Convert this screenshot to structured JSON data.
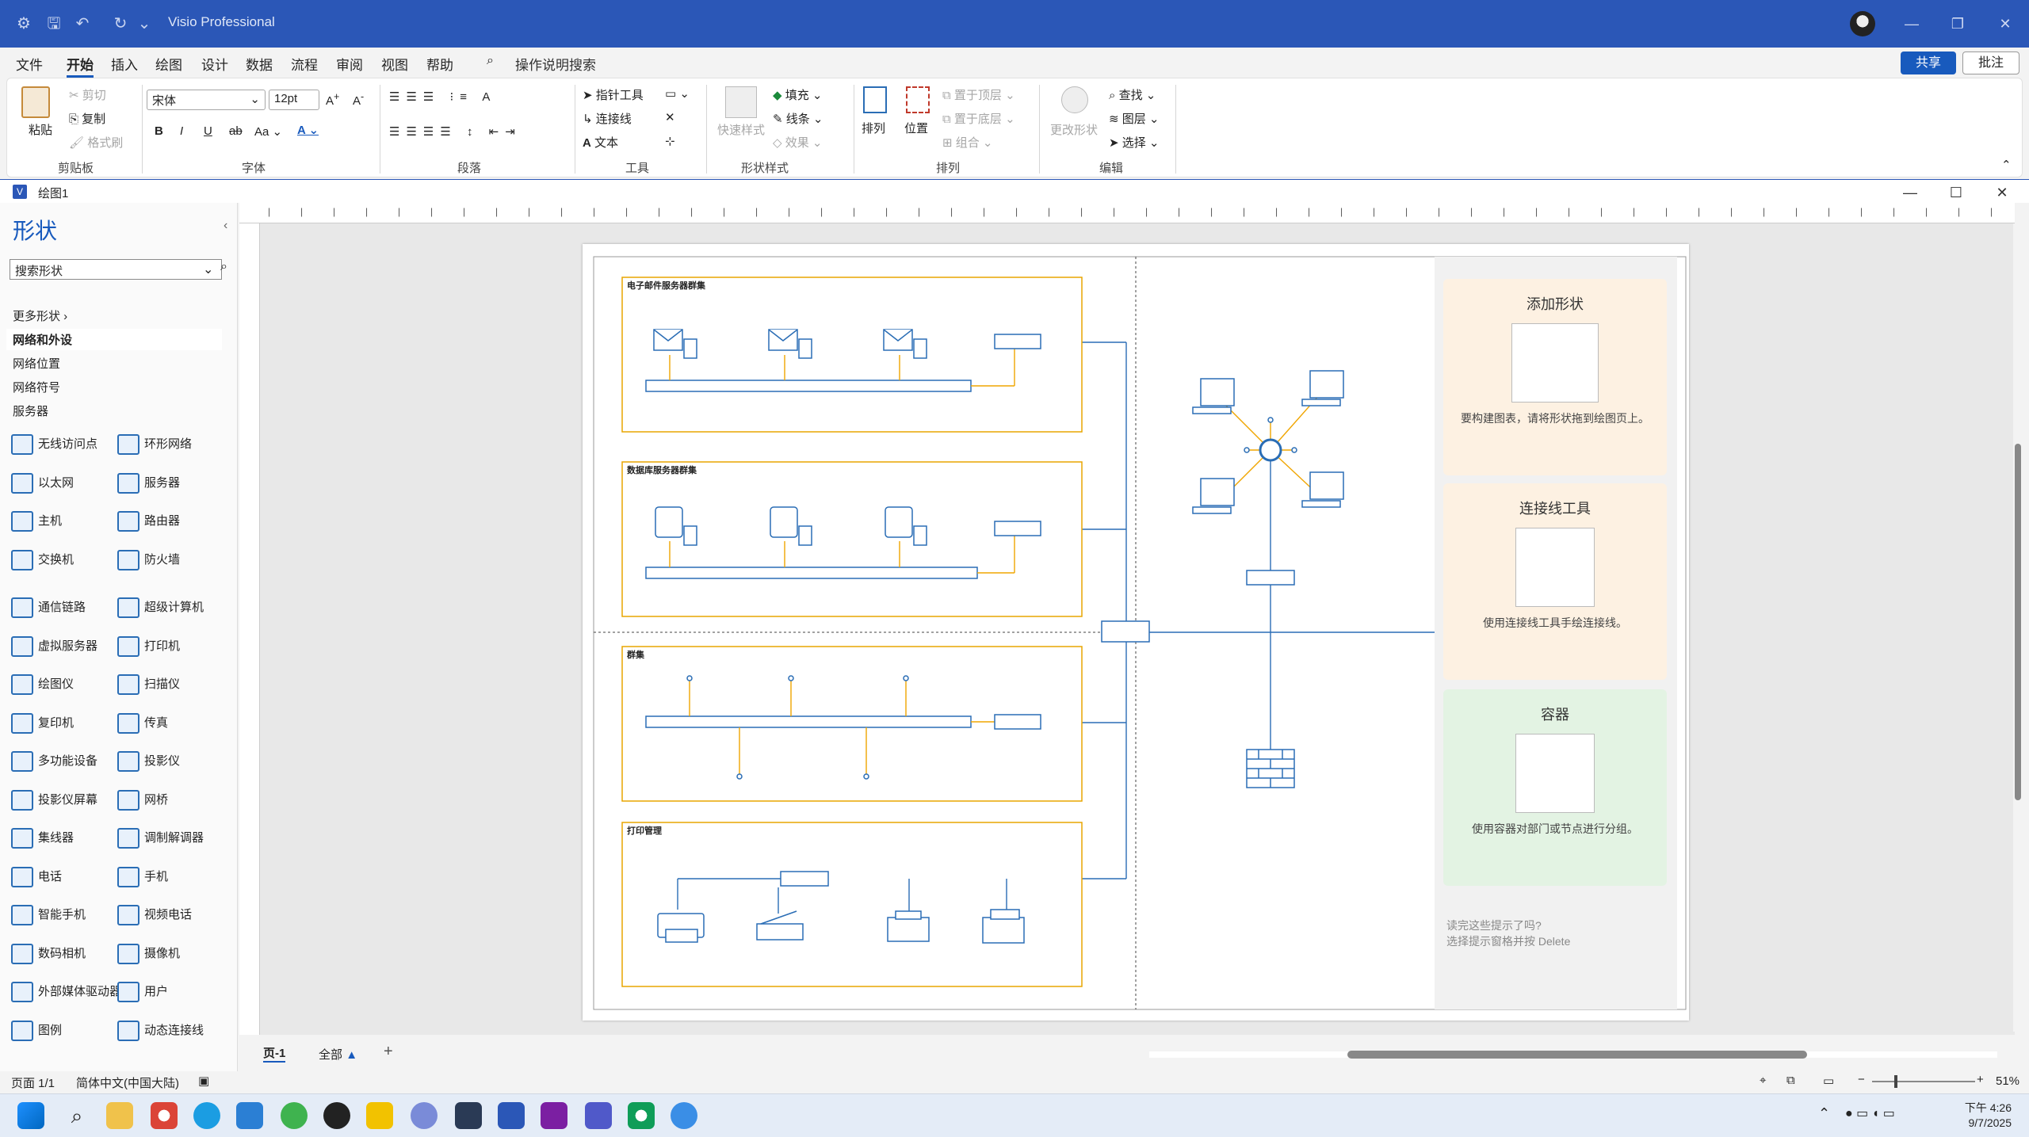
{
  "titlebar": {
    "app_title": "Visio Professional"
  },
  "menu": {
    "tabs": [
      "文件",
      "开始",
      "插入",
      "绘图",
      "设计",
      "数据",
      "流程",
      "审阅",
      "视图",
      "帮助"
    ],
    "active": "开始",
    "tell_me": "操作说明搜索",
    "share": "共享",
    "comment": "批注"
  },
  "ribbon": {
    "clipboard": {
      "paste": "粘贴",
      "cut": "剪切",
      "copy": "复制",
      "format_painter": "格式刷",
      "label": "剪贴板"
    },
    "font": {
      "family": "宋体",
      "size": "12pt",
      "label": "字体",
      "case": "Aa"
    },
    "paragraph": {
      "label": "段落"
    },
    "tools": {
      "pointer": "指针工具",
      "connector": "连接线",
      "text": "文本",
      "label": "工具"
    },
    "shape_styles": {
      "quick_styles": "快速样式",
      "fill": "填充",
      "line": "线条",
      "effects": "效果",
      "label": "形状样式"
    },
    "arrange": {
      "arrange": "排列",
      "position": "位置",
      "bring_front": "置于顶层",
      "send_back": "置于底层",
      "group": "组合",
      "label": "排列"
    },
    "editing": {
      "change_shape": "更改形状",
      "find": "查找",
      "layers": "图层",
      "select": "选择",
      "label": "编辑"
    }
  },
  "document": {
    "title": "绘图1"
  },
  "shapes_pane": {
    "title": "形状",
    "search_placeholder": "搜索形状",
    "more_shapes": "更多形状",
    "stencils": [
      "网络和外设",
      "网络位置",
      "网络符号",
      "服务器"
    ],
    "selected_stencil": "网络和外设",
    "items": [
      [
        "无线访问点",
        "环形网络"
      ],
      [
        "以太网",
        "服务器"
      ],
      [
        "主机",
        "路由器"
      ],
      [
        "交换机",
        "防火墙"
      ],
      [
        "通信链路",
        "超级计算机"
      ],
      [
        "虚拟服务器",
        "打印机"
      ],
      [
        "绘图仪",
        "扫描仪"
      ],
      [
        "复印机",
        "传真"
      ],
      [
        "多功能设备",
        "投影仪"
      ],
      [
        "投影仪屏幕",
        "网桥"
      ],
      [
        "集线器",
        "调制解调器"
      ],
      [
        "电话",
        "手机"
      ],
      [
        "智能手机",
        "视频电话"
      ],
      [
        "数码相机",
        "摄像机"
      ],
      [
        "外部媒体驱动器",
        "用户"
      ],
      [
        "图例",
        "动态连接线"
      ]
    ]
  },
  "diagram": {
    "containers": [
      "电子邮件服务器群集",
      "数据库服务器群集",
      "群集",
      "打印管理"
    ]
  },
  "tips": {
    "add_shapes": {
      "title": "添加形状",
      "text": "要构建图表，请将形状拖到绘图页上。"
    },
    "connector_tool": {
      "title": "连接线工具",
      "text": "使用连接线工具手绘连接线。"
    },
    "container": {
      "title": "容器",
      "text": "使用容器对部门或节点进行分组。"
    },
    "footer": {
      "line1": "读完这些提示了吗?",
      "line2": "选择提示窗格并按 Delete"
    }
  },
  "sheets": {
    "current": "页-1",
    "all": "全部",
    "add": "+"
  },
  "status": {
    "page": "页面 1/1",
    "language": "简体中文(中国大陆)",
    "zoom": "51%"
  },
  "clock": {
    "time": "下午 4:26",
    "date": "9/7/2025"
  },
  "colors": {
    "accent": "#185abd",
    "titlebar": "#2b57b7",
    "container_border": "#e9a500",
    "network_line": "#2a6db5",
    "orange_line": "#f0a500"
  }
}
